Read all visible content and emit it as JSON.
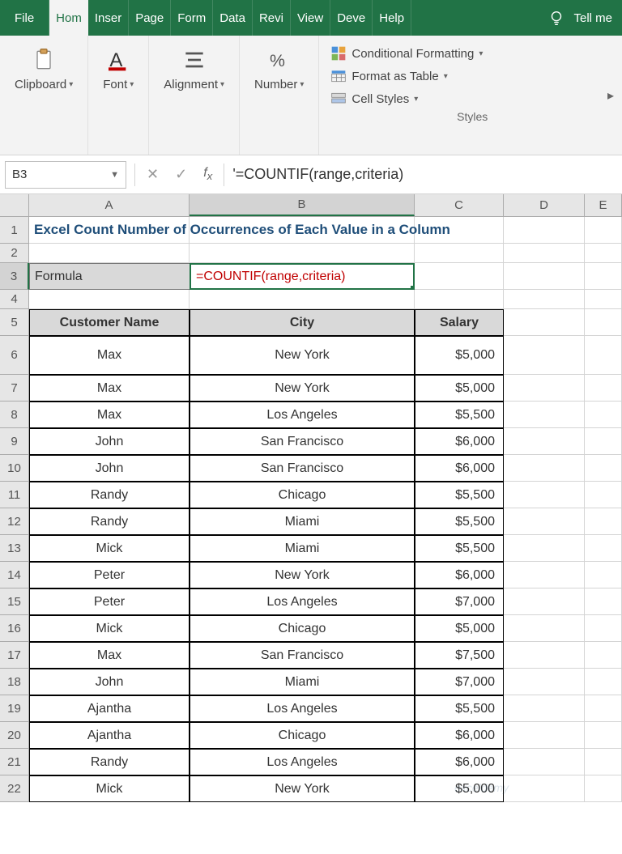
{
  "tabs": [
    "File",
    "Hom",
    "Inser",
    "Page",
    "Form",
    "Data",
    "Revi",
    "View",
    "Deve",
    "Help"
  ],
  "active_tab": "Hom",
  "tell_me": "Tell me",
  "ribbon": {
    "clipboard": "Clipboard",
    "font": "Font",
    "alignment": "Alignment",
    "number": "Number",
    "styles": "Styles",
    "cond_format": "Conditional Formatting",
    "format_table": "Format as Table",
    "cell_styles": "Cell Styles"
  },
  "name_box": "B3",
  "formula_bar": "'=COUNTIF(range,criteria)",
  "title": "Excel Count Number of Occurrences of Each Value in a Column",
  "formula_label": "Formula",
  "formula_value": "=COUNTIF(range,criteria)",
  "columns": [
    "A",
    "B",
    "C",
    "D",
    "E"
  ],
  "headers": {
    "name": "Customer Name",
    "city": "City",
    "salary": "Salary"
  },
  "rows": [
    {
      "n": "6",
      "name": "Max",
      "city": "New York",
      "salary": "$5,000"
    },
    {
      "n": "7",
      "name": "Max",
      "city": "New York",
      "salary": "$5,000"
    },
    {
      "n": "8",
      "name": "Max",
      "city": "Los Angeles",
      "salary": "$5,500"
    },
    {
      "n": "9",
      "name": "John",
      "city": "San Francisco",
      "salary": "$6,000"
    },
    {
      "n": "10",
      "name": "John",
      "city": "San Francisco",
      "salary": "$6,000"
    },
    {
      "n": "11",
      "name": "Randy",
      "city": "Chicago",
      "salary": "$5,500"
    },
    {
      "n": "12",
      "name": "Randy",
      "city": "Miami",
      "salary": "$5,500"
    },
    {
      "n": "13",
      "name": "Mick",
      "city": "Miami",
      "salary": "$5,500"
    },
    {
      "n": "14",
      "name": "Peter",
      "city": "New York",
      "salary": "$6,000"
    },
    {
      "n": "15",
      "name": "Peter",
      "city": "Los Angeles",
      "salary": "$7,000"
    },
    {
      "n": "16",
      "name": "Mick",
      "city": "Chicago",
      "salary": "$5,000"
    },
    {
      "n": "17",
      "name": "Max",
      "city": "San Francisco",
      "salary": "$7,500"
    },
    {
      "n": "18",
      "name": "John",
      "city": "Miami",
      "salary": "$7,000"
    },
    {
      "n": "19",
      "name": "Ajantha",
      "city": "Los Angeles",
      "salary": "$5,500"
    },
    {
      "n": "20",
      "name": "Ajantha",
      "city": "Chicago",
      "salary": "$6,000"
    },
    {
      "n": "21",
      "name": "Randy",
      "city": "Los Angeles",
      "salary": "$6,000"
    },
    {
      "n": "22",
      "name": "Mick",
      "city": "New York",
      "salary": "$5,000"
    }
  ],
  "watermark": "exceldemy"
}
